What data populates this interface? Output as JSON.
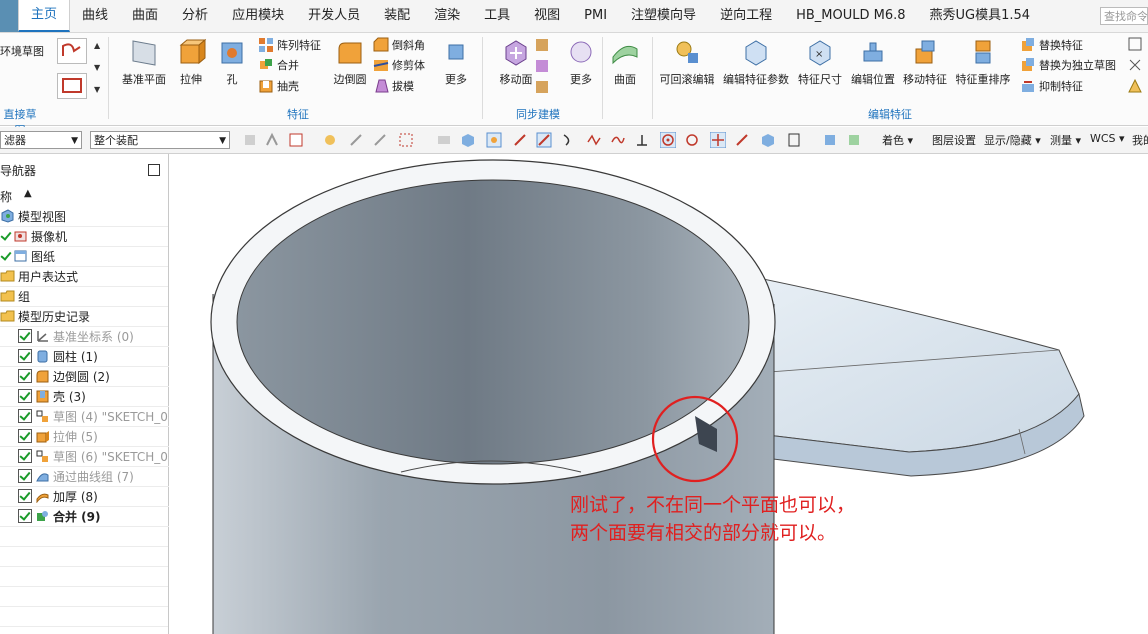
{
  "menu": {
    "tabs": [
      "主页",
      "曲线",
      "曲面",
      "分析",
      "应用模块",
      "开发人员",
      "装配",
      "渲染",
      "工具",
      "视图",
      "PMI",
      "注塑模向导",
      "逆向工程",
      "HB_MOULD M6.8",
      "燕秀UG模具1.54"
    ],
    "active_tab": "主页",
    "search_placeholder": "查找命令"
  },
  "ribbon": {
    "sketch_group": {
      "env_sketch": "环境草图",
      "label": "直接草图"
    },
    "feature_group": {
      "label": "特征",
      "datum_plane": "基准平面",
      "extrude": "拉伸",
      "hole": "孔",
      "pattern_feature": "阵列特征",
      "unite": "合并",
      "shell": "抽壳",
      "edge_blend": "边倒圆",
      "chamfer": "倒斜角",
      "trim_body": "修剪体",
      "draft": "拔模",
      "more": "更多"
    },
    "sync_group": {
      "label": "同步建模",
      "move_face": "移动面",
      "more": "更多"
    },
    "surface_group": {
      "surface": "曲面"
    },
    "edit_group": {
      "label": "编辑特征",
      "rollback_edit": "可回滚编辑",
      "edit_params": "编辑特征参数",
      "feature_dimension": "特征尺寸",
      "edit_position": "编辑位置",
      "move_feature": "移动特征",
      "reorder": "特征重排序",
      "replace_feature": "替换特征",
      "replace_sketch": "替换为独立草图",
      "suppress": "抑制特征"
    }
  },
  "toolbar2": {
    "filter": "滤器",
    "assembly_scope": "整个装配",
    "color": "着色",
    "layer_settings": "图层设置",
    "show_hide": "显示/隐藏",
    "measure": "测量",
    "wcs": "WCS",
    "more": "我的"
  },
  "navigator": {
    "title": "导航器",
    "column": "称",
    "items": [
      {
        "label": "模型视图",
        "kind": "view"
      },
      {
        "label": "摄像机",
        "kind": "camera"
      },
      {
        "label": "图纸",
        "kind": "drawing"
      },
      {
        "label": "用户表达式",
        "kind": "folder"
      },
      {
        "label": "组",
        "kind": "folder"
      },
      {
        "label": "模型历史记录",
        "kind": "folder"
      },
      {
        "label": "基准坐标系 (0)",
        "kind": "feature",
        "dim": true
      },
      {
        "label": "圆柱 (1)",
        "kind": "feature"
      },
      {
        "label": "边倒圆 (2)",
        "kind": "feature"
      },
      {
        "label": "壳 (3)",
        "kind": "feature"
      },
      {
        "label": "草图 (4) \"SKETCH_0...",
        "kind": "feature",
        "dim": true
      },
      {
        "label": "拉伸 (5)",
        "kind": "feature",
        "dim": true
      },
      {
        "label": "草图 (6) \"SKETCH_0...",
        "kind": "feature",
        "dim": true
      },
      {
        "label": "通过曲线组 (7)",
        "kind": "feature",
        "dim": true
      },
      {
        "label": "加厚 (8)",
        "kind": "feature"
      },
      {
        "label": "合并 (9)",
        "kind": "feature",
        "bold": true
      }
    ]
  },
  "annotation": {
    "line1": "刚试了，不在同一个平面也可以，",
    "line2": "两个面要有相交的部分就可以。",
    "color": "#e02020"
  },
  "colors": {
    "accent": "#1e73be",
    "model_inner": "#7a858f",
    "model_outer": "#a9b3bc",
    "lip": "#dce6f0"
  }
}
